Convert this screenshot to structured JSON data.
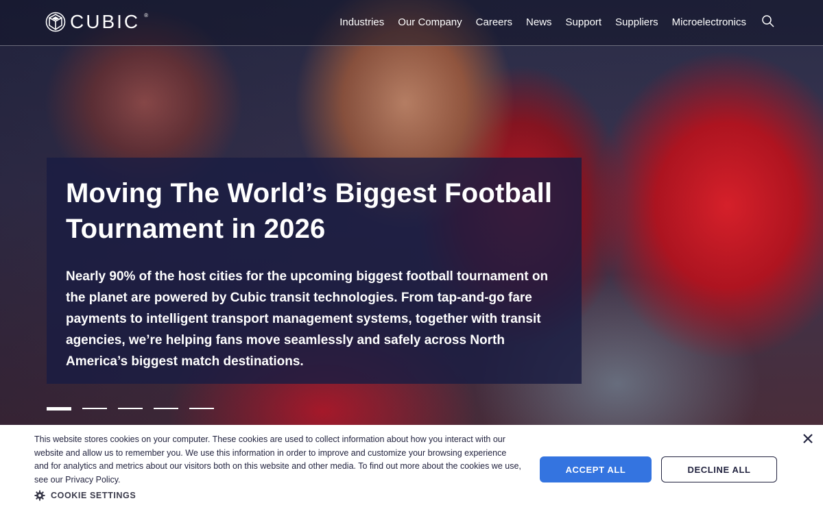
{
  "brand": {
    "name": "CUBIC",
    "reg_mark": "®"
  },
  "nav": {
    "items": [
      {
        "label": "Industries"
      },
      {
        "label": "Our Company"
      },
      {
        "label": "Careers"
      },
      {
        "label": "News"
      },
      {
        "label": "Support"
      },
      {
        "label": "Suppliers"
      },
      {
        "label": "Microelectronics"
      }
    ],
    "search_icon": "search-icon"
  },
  "hero": {
    "title": "Moving The World’s Biggest Football Tournament in 2026",
    "body": "Nearly 90% of the host cities for the upcoming biggest football tournament on the planet are powered by Cubic transit technologies. From tap-and-go fare payments to intelligent transport management systems, together with transit agencies, we’re helping fans move seamlessly and safely across North America’s biggest match destinations.",
    "slides_total": 5,
    "active_slide": 1
  },
  "cookie_banner": {
    "text_before_link": "This website stores cookies on your computer. These cookies are used to collect information about how you interact with our website and allow us to remember you. We use this information in order to improve and customize your browsing experience and for analytics and metrics about our visitors both on this website and other media. To find out more about the cookies we use, see our ",
    "link_label": "Privacy Policy",
    "text_after_link": ".",
    "settings_label": "COOKIE SETTINGS",
    "accept_label": "ACCEPT ALL",
    "decline_label": "DECLINE ALL",
    "accept_color": "#3474e0"
  }
}
